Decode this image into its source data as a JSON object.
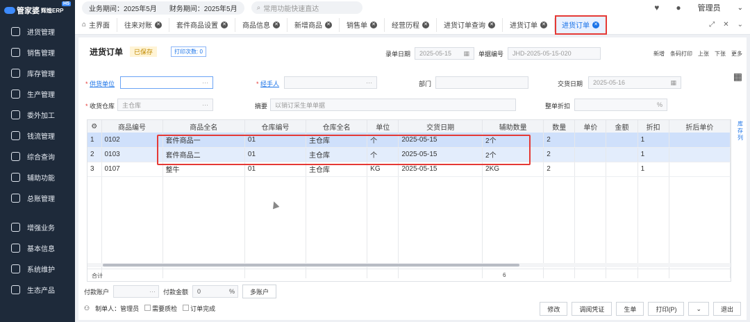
{
  "app": {
    "logo": "管家婆",
    "logo_sub": "辉煌ERP",
    "logo_badge": "H5"
  },
  "sidebar": {
    "items": [
      {
        "label": "进货管理"
      },
      {
        "label": "销售管理"
      },
      {
        "label": "库存管理"
      },
      {
        "label": "生产管理"
      },
      {
        "label": "委外加工"
      },
      {
        "label": "钱流管理"
      },
      {
        "label": "综合查询"
      },
      {
        "label": "辅助功能"
      },
      {
        "label": "总账管理"
      }
    ],
    "items2": [
      {
        "label": "增强业务"
      },
      {
        "label": "基本信息"
      },
      {
        "label": "系统维护"
      },
      {
        "label": "生态产品"
      }
    ]
  },
  "topbar": {
    "business_period": "业务期间：2025年5月",
    "finance_period": "财务期间：2025年5月",
    "search_placeholder": "常用功能快速直达",
    "user": "管理员"
  },
  "tabs": [
    {
      "label": "主界面",
      "close": false
    },
    {
      "label": "往来对账",
      "close": true
    },
    {
      "label": "套件商品设置",
      "close": true
    },
    {
      "label": "商品信息",
      "close": true
    },
    {
      "label": "新增商品",
      "close": true
    },
    {
      "label": "销售单",
      "close": true
    },
    {
      "label": "经营历程",
      "close": true
    },
    {
      "label": "进货订单查询",
      "close": true
    },
    {
      "label": "进货订单",
      "close": true
    },
    {
      "label": "进货订单",
      "close": true,
      "active": true
    }
  ],
  "doc": {
    "title": "进货订单",
    "saved": "已保存",
    "print_count": "打印次数: 0",
    "entry_date_label": "录单日期",
    "entry_date": "2025-05-15",
    "doc_no_label": "单据编号",
    "doc_no": "JHD-2025-05-15-020",
    "actions": [
      "新增",
      "条码打印",
      "上张",
      "下张",
      "更多"
    ]
  },
  "form": {
    "supplier_label": "供货单位",
    "handler_label": "经手人",
    "dept_label": "部门",
    "delivery_date_label": "交货日期",
    "delivery_date": "2025-05-16",
    "warehouse_label": "收货仓库",
    "warehouse": "主仓库",
    "summary_label": "摘要",
    "summary": "以销订采生单单据",
    "discount_label": "整单折扣",
    "discount_unit": "%"
  },
  "table": {
    "headers": [
      "",
      "商品编号",
      "商品全名",
      "仓库编号",
      "仓库全名",
      "单位",
      "交货日期",
      "辅助数量",
      "数量",
      "单价",
      "金额",
      "折扣",
      "折后单价"
    ],
    "rows": [
      [
        "1",
        "0102",
        "套件商品一",
        "01",
        "主仓库",
        "个",
        "2025-05-15",
        "2个",
        "2",
        "",
        "",
        "1",
        ""
      ],
      [
        "2",
        "0103",
        "套件商品二",
        "01",
        "主仓库",
        "个",
        "2025-05-15",
        "2个",
        "2",
        "",
        "",
        "1",
        ""
      ],
      [
        "3",
        "0107",
        "整牛",
        "01",
        "主仓库",
        "KG",
        "2025-05-15",
        "2KG",
        "2",
        "",
        "",
        "1",
        ""
      ]
    ],
    "total_label": "合计",
    "total_qty": "6",
    "side_label": "库存列"
  },
  "footer": {
    "pay_account_label": "付款账户",
    "pay_amount_label": "付款金额",
    "pay_amount": "0",
    "pay_unit": "%",
    "multi_account": "多账户",
    "maker_label": "制单人：管理员",
    "need_qc": "需要质检",
    "order_done": "订单完成",
    "buttons": [
      "修改",
      "调阅凭证",
      "生单",
      "打印(P)",
      "",
      "退出"
    ]
  }
}
